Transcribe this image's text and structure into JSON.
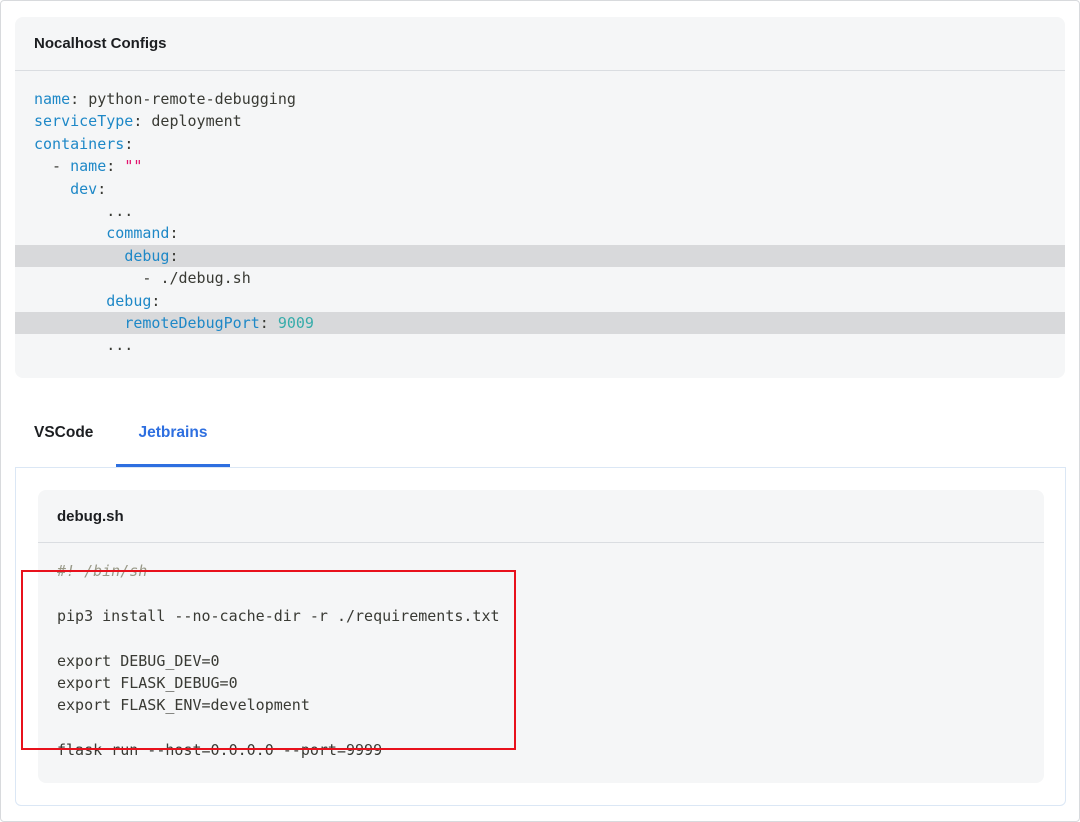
{
  "config_card": {
    "title": "Nocalhost Configs",
    "lines": [
      {
        "indent": "",
        "key": "name",
        "sep": ": ",
        "value": "python-remote-debugging",
        "vtype": "plain",
        "highlight": false
      },
      {
        "indent": "",
        "key": "serviceType",
        "sep": ": ",
        "value": "deployment",
        "vtype": "plain",
        "highlight": false
      },
      {
        "indent": "",
        "key": "containers",
        "sep": ":",
        "value": "",
        "vtype": "plain",
        "highlight": false
      },
      {
        "indent": "  - ",
        "key": "name",
        "sep": ": ",
        "value": "\"\"",
        "vtype": "str",
        "highlight": false
      },
      {
        "indent": "    ",
        "key": "dev",
        "sep": ":",
        "value": "",
        "vtype": "plain",
        "highlight": false
      },
      {
        "indent": "        ",
        "key": "",
        "sep": "",
        "value": "...",
        "vtype": "plain",
        "highlight": false
      },
      {
        "indent": "        ",
        "key": "command",
        "sep": ":",
        "value": "",
        "vtype": "plain",
        "highlight": false
      },
      {
        "indent": "          ",
        "key": "debug",
        "sep": ":",
        "value": "",
        "vtype": "plain",
        "highlight": true
      },
      {
        "indent": "            - ",
        "key": "",
        "sep": "",
        "value": "./debug.sh",
        "vtype": "plain",
        "highlight": false
      },
      {
        "indent": "        ",
        "key": "debug",
        "sep": ":",
        "value": "",
        "vtype": "plain",
        "highlight": false
      },
      {
        "indent": "          ",
        "key": "remoteDebugPort",
        "sep": ": ",
        "value": "9009",
        "vtype": "num",
        "highlight": true
      },
      {
        "indent": "        ",
        "key": "",
        "sep": "",
        "value": "...",
        "vtype": "plain",
        "highlight": false
      }
    ]
  },
  "tabs": {
    "vscode": "VSCode",
    "jetbrains": "Jetbrains",
    "active": "Jetbrains"
  },
  "script_card": {
    "title": "debug.sh",
    "lines": [
      {
        "text": "#! /bin/sh",
        "type": "cmt"
      },
      {
        "text": "",
        "type": "plain"
      },
      {
        "text": "pip3 install --no-cache-dir -r ./requirements.txt",
        "type": "plain"
      },
      {
        "text": "",
        "type": "plain"
      },
      {
        "text": "export DEBUG_DEV=0",
        "type": "plain"
      },
      {
        "text": "export FLASK_DEBUG=0",
        "type": "plain"
      },
      {
        "text": "export FLASK_ENV=development",
        "type": "plain"
      },
      {
        "text": "",
        "type": "plain"
      },
      {
        "text": "flask run --host=0.0.0.0 --port=9999",
        "type": "plain"
      }
    ]
  },
  "colors": {
    "accent": "#2e6fe0",
    "highlight_box": "#e8111c",
    "yaml_key": "#1e88c7",
    "string": "#e3116c",
    "number": "#36acaa"
  }
}
